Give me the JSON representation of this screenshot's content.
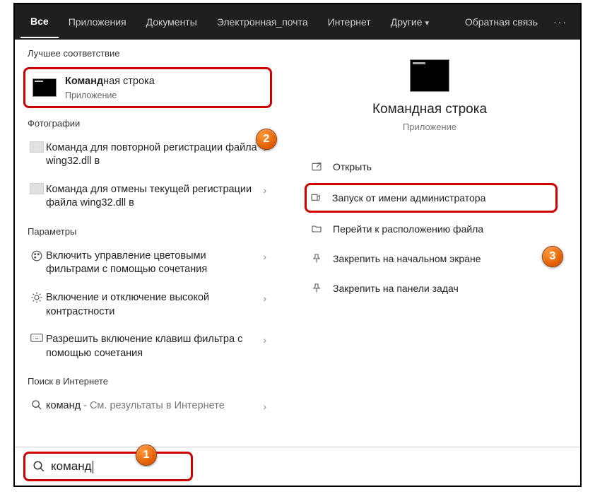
{
  "topbar": {
    "tabs": [
      "Все",
      "Приложения",
      "Документы",
      "Электронная_почта",
      "Интернет",
      "Другие"
    ],
    "feedback": "Обратная связь"
  },
  "sections": {
    "best_match": "Лучшее соответствие",
    "photos": "Фотографии",
    "settings": "Параметры",
    "web": "Поиск в Интернете"
  },
  "best": {
    "title_bold": "Команд",
    "title_rest": "ная строка",
    "subtitle": "Приложение"
  },
  "photos": [
    {
      "bold": "Команда",
      "rest": " для повторной регистрации файла wing32.dll в"
    },
    {
      "bold": "Команда",
      "rest": " для отмены текущей регистрации файла wing32.dll в"
    }
  ],
  "params": [
    {
      "text": "Включить управление цветовыми фильтрами с помощью сочетания"
    },
    {
      "text": "Включение и отключение высокой контрастности"
    },
    {
      "text": "Разрешить включение клавиш фильтра с помощью сочетания"
    }
  ],
  "web": {
    "bold": "команд",
    "rest": " - См. результаты в Интернете"
  },
  "preview": {
    "title": "Командная строка",
    "subtitle": "Приложение"
  },
  "actions": {
    "open": "Открыть",
    "run_admin": "Запуск от имени администратора",
    "open_location": "Перейти к расположению файла",
    "pin_start": "Закрепить на начальном экране",
    "pin_taskbar": "Закрепить на панели задач"
  },
  "search": {
    "query": "команд"
  },
  "callouts": {
    "c1": "1",
    "c2": "2",
    "c3": "3"
  }
}
